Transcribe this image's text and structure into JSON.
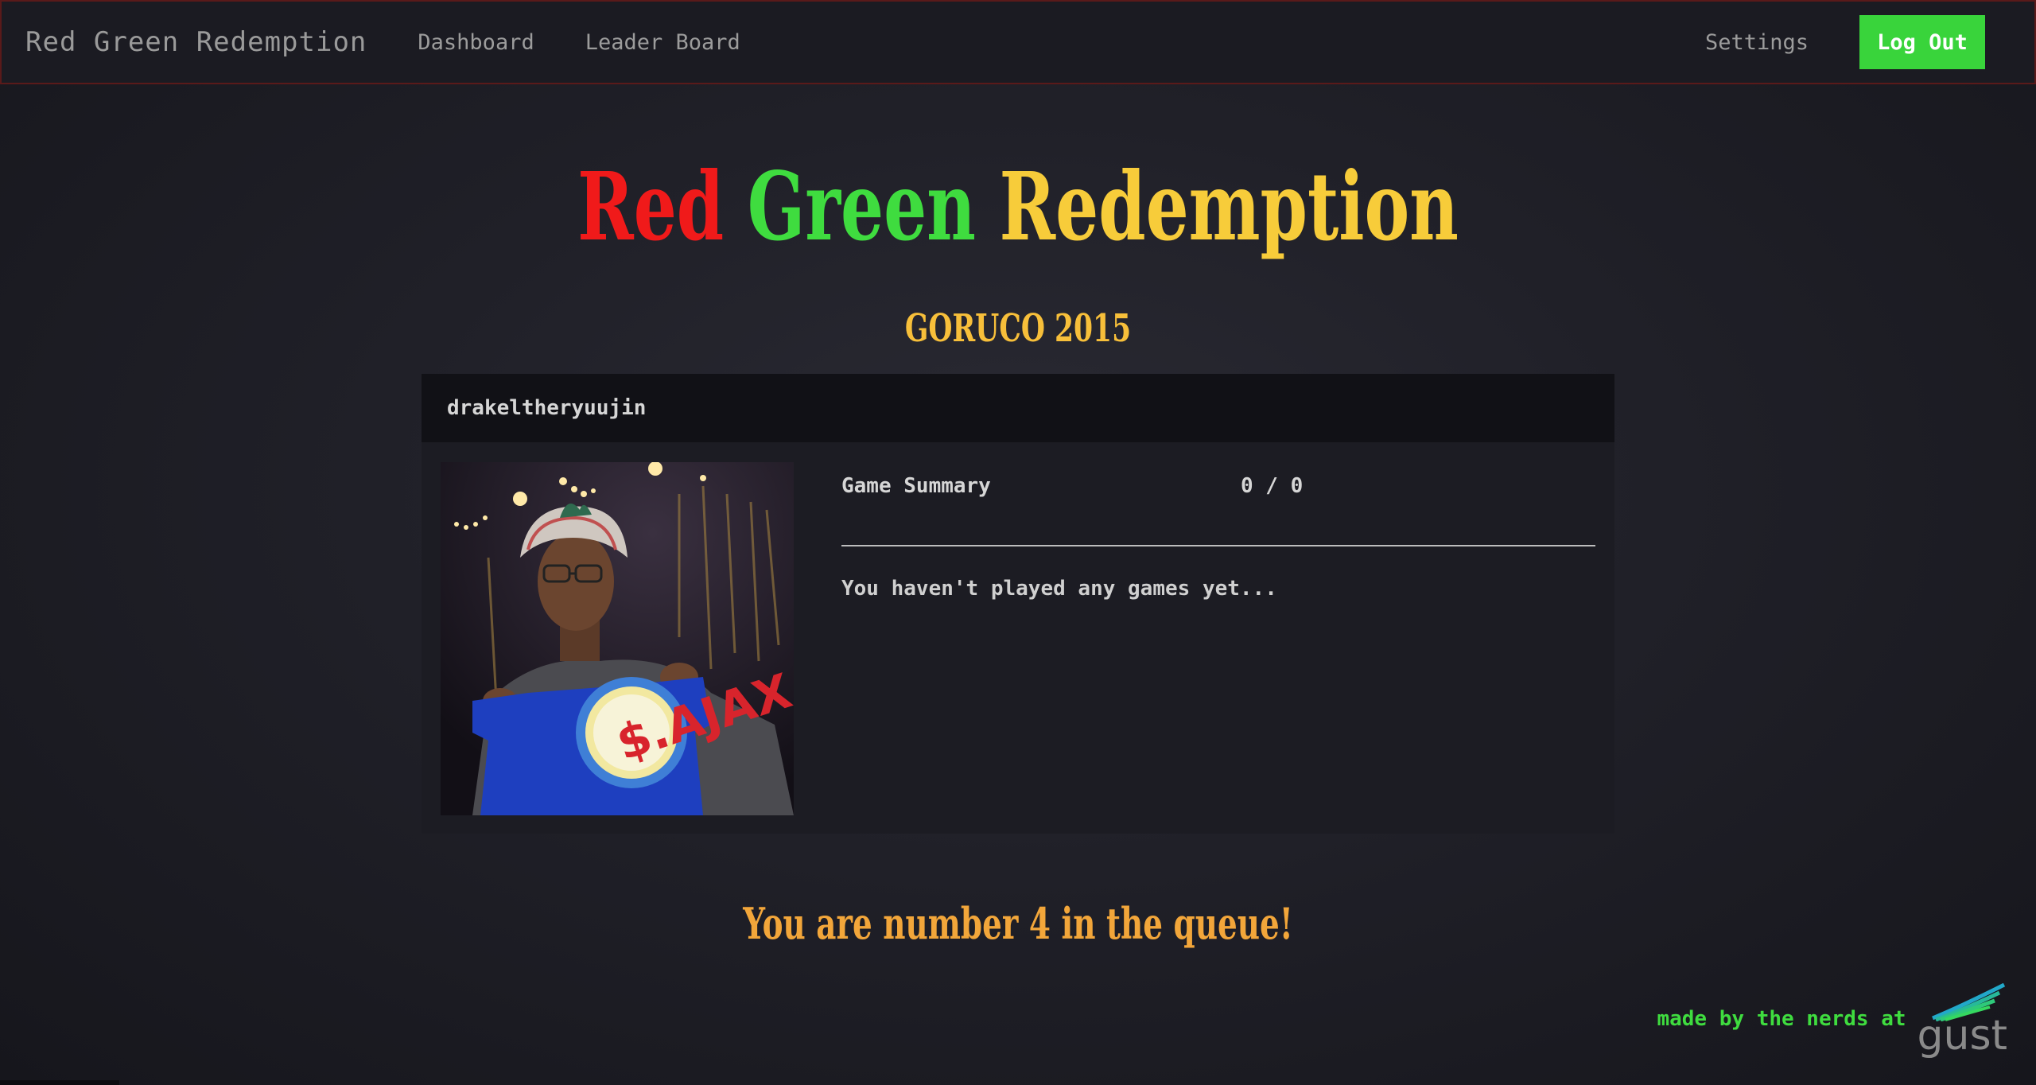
{
  "navbar": {
    "brand": "Red Green Redemption",
    "links": [
      "Dashboard",
      "Leader Board"
    ],
    "settings": "Settings",
    "logout": "Log Out"
  },
  "hero": {
    "word_red": "Red",
    "word_green": "Green",
    "word_yellow": "Redemption",
    "event": "GORUCO 2015"
  },
  "profile": {
    "username": "drakeltheryuujin",
    "summary_label": "Game Summary",
    "summary_score": "0 / 0",
    "empty_message": "You haven't played any games yet..."
  },
  "queue": {
    "message": "You are number 4 in the queue!"
  },
  "footer": {
    "credit": "made by the nerds at",
    "logo_text": "gust"
  },
  "colors": {
    "red": "#f01a1a",
    "green": "#3fdc3f",
    "yellow": "#f7cc3a",
    "accent_button": "#39d43b"
  }
}
